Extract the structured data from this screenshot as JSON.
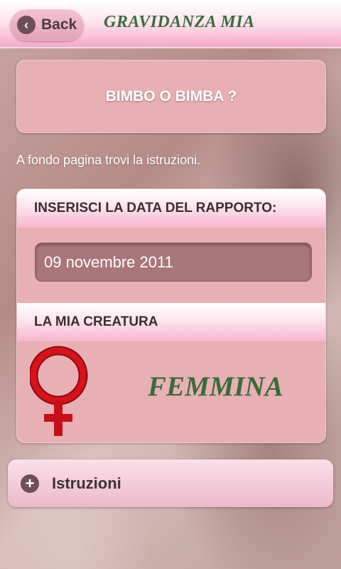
{
  "header": {
    "back_label": "Back",
    "app_title": "GRAVIDANZA MIA"
  },
  "title_card": {
    "title": "BIMBO O BIMBA ?"
  },
  "note": "A fondo pagina trovi la istruzioni.",
  "form": {
    "date_section_title": "INSERISCI LA DATA DEL RAPPORTO:",
    "date_value": "09 novembre 2011",
    "result_section_title": "LA MIA CREATURA",
    "result_value": "FEMMINA",
    "result_icon": "venus-icon"
  },
  "instructions": {
    "label": "Istruzioni",
    "icon": "plus-icon"
  },
  "colors": {
    "header_pink": "#f7a9c9",
    "card_pink": "#e8b0b4",
    "input_bg": "#a9767b",
    "title_green": "#3c6b3f",
    "venus_red": "#d8111b"
  }
}
